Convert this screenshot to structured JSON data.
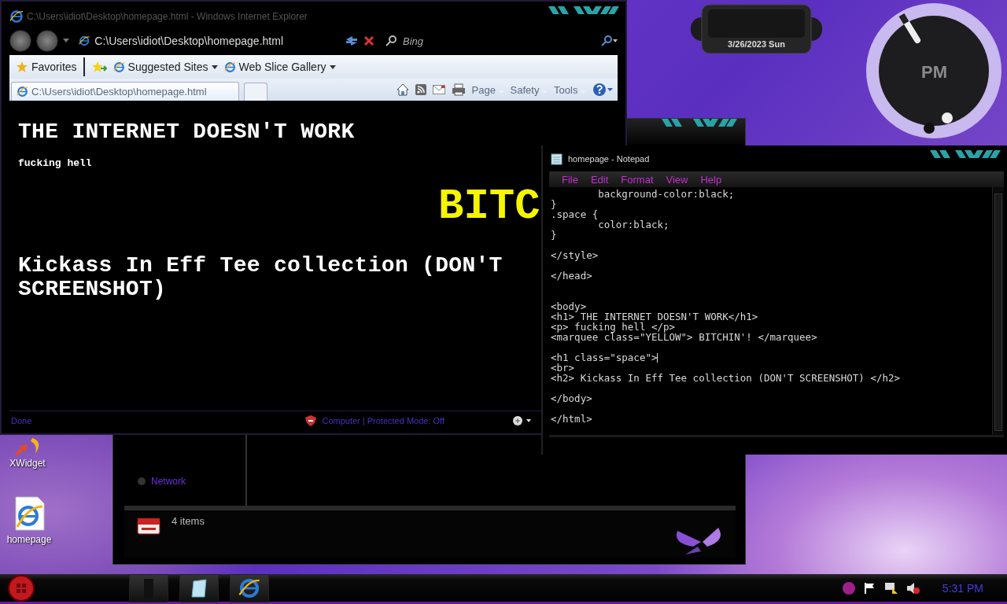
{
  "desktop": {
    "icons": [
      {
        "label": "XWidget",
        "kind": "widget"
      },
      {
        "label": "homepage",
        "kind": "browser"
      }
    ]
  },
  "gadgets": {
    "date": "3/26/2023 Sun",
    "clock": {
      "label": "PM"
    }
  },
  "explorer": {
    "nav_items": [
      "Network"
    ],
    "details": "4 items"
  },
  "browser": {
    "title": "C:\\Users\\idiot\\Desktop\\homepage.html - Windows Internet Explorer",
    "address": "C:\\Users\\idiot\\Desktop\\homepage.html",
    "search": {
      "placeholder": "Bing"
    },
    "favorites_label": "Favorites",
    "favorites": [
      {
        "label": "Suggested Sites"
      },
      {
        "label": "Web Slice Gallery"
      }
    ],
    "tabs": [
      {
        "label": "C:\\Users\\idiot\\Desktop\\homepage.html",
        "selected": true
      }
    ],
    "commands": [
      "Page",
      "Safety",
      "Tools"
    ],
    "page": [
      {
        "kind": "h1",
        "text": "THE INTERNET DOESN'T WORK"
      },
      {
        "kind": "p",
        "text": "fucking hell"
      },
      {
        "kind": "marquee",
        "text": "BITC"
      },
      {
        "kind": "h2",
        "text": "Kickass In Eff Tee collection (DON'T SCREENSHOT)"
      }
    ],
    "status": "Done",
    "zone": "Computer | Protected Mode: Off"
  },
  "notepad": {
    "title": "homepage - Notepad",
    "menu": [
      "File",
      "Edit",
      "Format",
      "View",
      "Help"
    ],
    "lines": [
      {
        "kind": "code",
        "text": "        background-color:black;"
      },
      {
        "kind": "code",
        "text": "}"
      },
      {
        "kind": "code",
        "text": ".space {"
      },
      {
        "kind": "code",
        "text": "        color:black;"
      },
      {
        "kind": "code",
        "text": "}"
      },
      {
        "kind": "blank"
      },
      {
        "kind": "code",
        "text": "</style>"
      },
      {
        "kind": "blank"
      },
      {
        "kind": "code",
        "text": "</head>"
      },
      {
        "kind": "blank"
      },
      {
        "kind": "blank"
      },
      {
        "kind": "code",
        "text": "<body>"
      },
      {
        "kind": "code",
        "text": "<h1> THE INTERNET DOESN'T WORK</h1>"
      },
      {
        "kind": "code",
        "text": "<p> fucking hell </p>"
      },
      {
        "kind": "code",
        "text": "<marquee class=\"YELLOW\"> BITCHIN'! </marquee>"
      },
      {
        "kind": "blank"
      },
      {
        "kind": "caret_line",
        "text": "<h1 class=\"space\">"
      },
      {
        "kind": "code",
        "text": "<br>"
      },
      {
        "kind": "code",
        "text": "<h2> Kickass In Eff Tee collection (DON'T SCREENSHOT) </h2>"
      },
      {
        "kind": "blank"
      },
      {
        "kind": "code",
        "text": "</body>"
      },
      {
        "kind": "blank"
      },
      {
        "kind": "code",
        "text": "</html>"
      }
    ]
  },
  "taskbar": {
    "clock": "5:31 PM"
  }
}
